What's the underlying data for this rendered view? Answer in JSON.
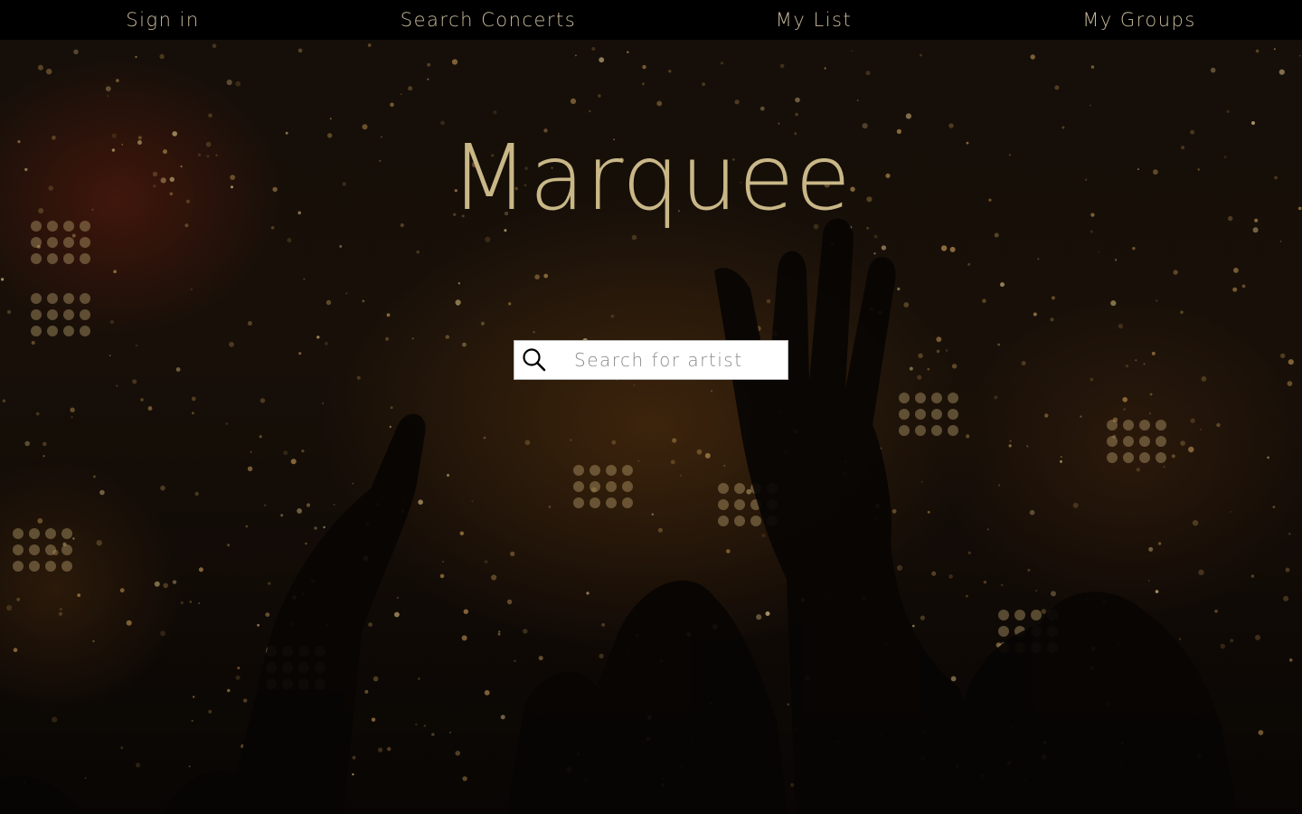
{
  "nav": {
    "items": [
      {
        "label": "Sign in"
      },
      {
        "label": "Search Concerts"
      },
      {
        "label": "My List"
      },
      {
        "label": "My Groups"
      }
    ]
  },
  "brand": {
    "title": "Marquee"
  },
  "search": {
    "placeholder": "Search for artist",
    "value": "",
    "icon": "search-icon"
  },
  "background": {
    "image": "concert-crowd-silhouettes-stage-lights"
  },
  "colors": {
    "nav_background": "#000000",
    "nav_text": "#c8b99a",
    "brand_text": "#c9b787",
    "search_background": "#ffffff",
    "placeholder_text": "#8a8a8a"
  }
}
